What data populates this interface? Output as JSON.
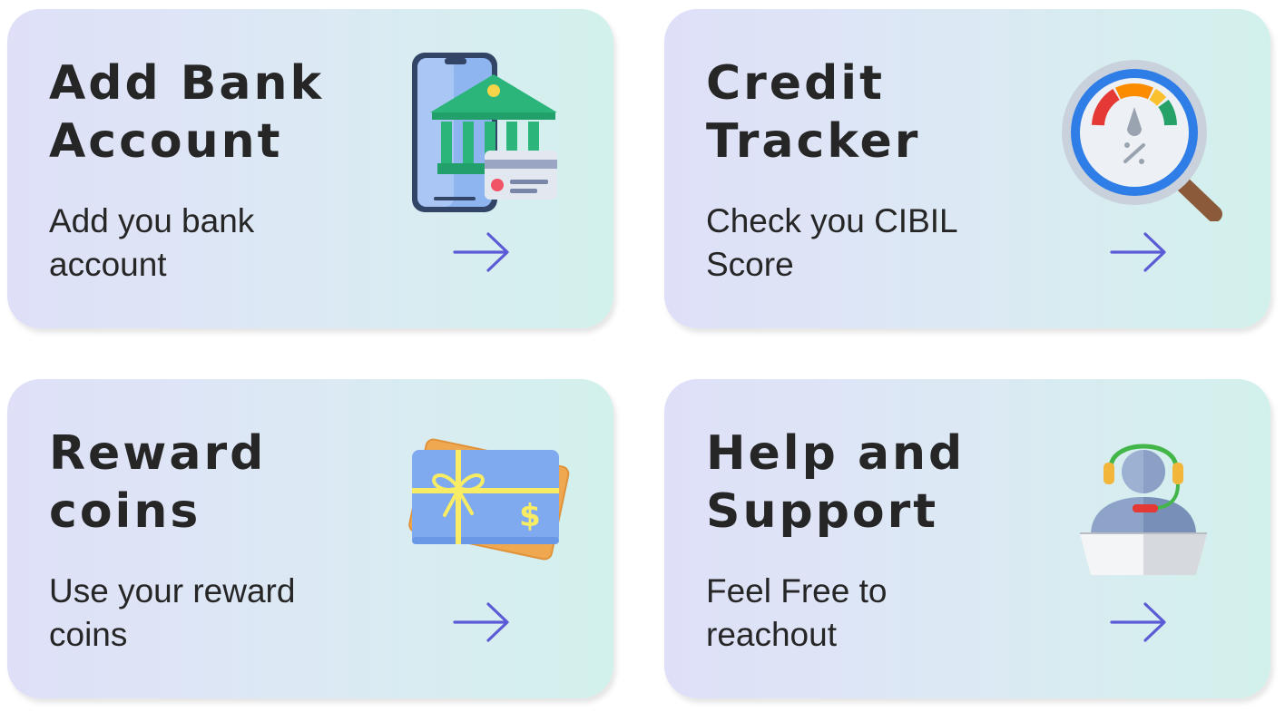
{
  "cards": [
    {
      "title": "Add Bank\nAccount",
      "description": "Add you bank\naccount",
      "icon": "bank-account-icon"
    },
    {
      "title": "Credit\nTracker",
      "description": "Check you CIBIL\nScore",
      "icon": "credit-score-icon"
    },
    {
      "title": "Reward\ncoins",
      "description": "Use your reward\ncoins",
      "icon": "gift-card-icon"
    },
    {
      "title": "Help and\nSupport",
      "description": "Feel Free to\nreachout",
      "icon": "customer-support-icon"
    }
  ],
  "colors": {
    "arrow": "#5b5bd6",
    "text": "#262626",
    "card_gradient_start": "#dfe0f8",
    "card_gradient_end": "#d2f1ec"
  }
}
